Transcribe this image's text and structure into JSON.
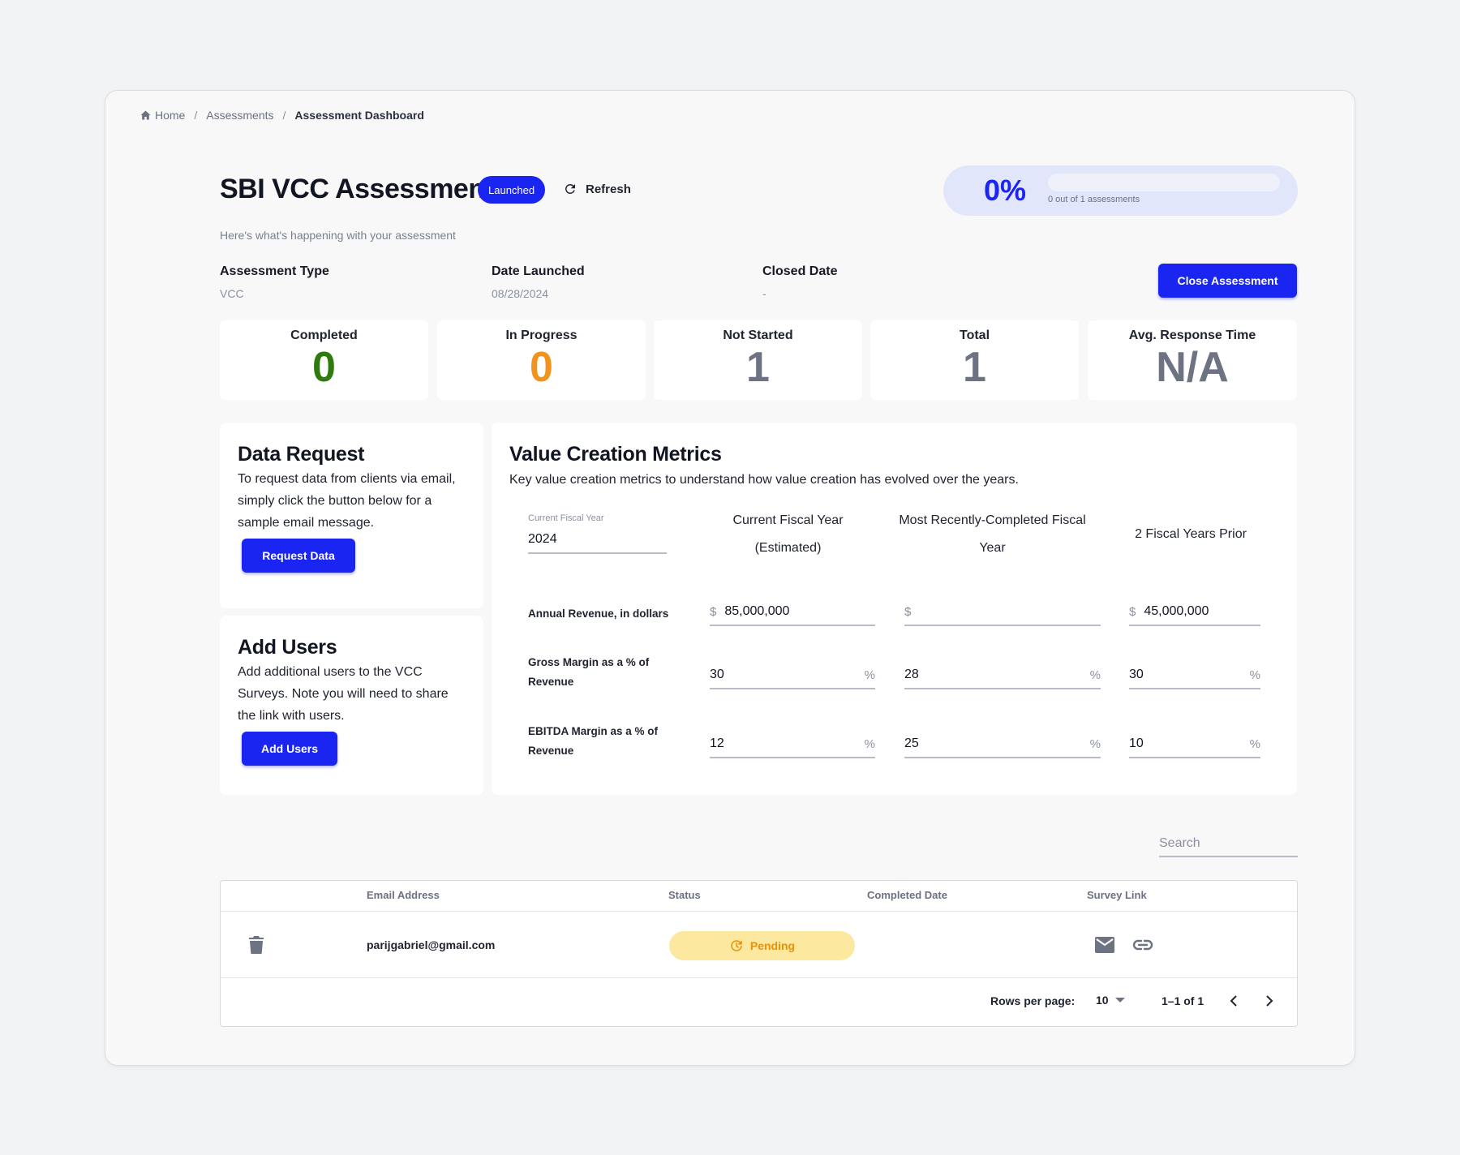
{
  "breadcrumb": {
    "home": "Home",
    "assessments": "Assessments",
    "current": "Assessment Dashboard"
  },
  "header": {
    "title": "SBI VCC Assessment",
    "status_badge": "Launched",
    "refresh_label": "Refresh",
    "subtitle": "Here's what's happening with your assessment"
  },
  "progress": {
    "percent_text": "0%",
    "fraction": 0,
    "caption": "0 out of 1 assessments"
  },
  "info": {
    "type_label": "Assessment Type",
    "type_value": "VCC",
    "launched_label": "Date Launched",
    "launched_value": "08/28/2024",
    "closed_label": "Closed Date",
    "closed_value": "-",
    "close_button": "Close Assessment"
  },
  "stats": [
    {
      "label": "Completed",
      "value": "0",
      "color": "#2f7a0f"
    },
    {
      "label": "In Progress",
      "value": "0",
      "color": "#f0941f"
    },
    {
      "label": "Not Started",
      "value": "1",
      "color": "#6d7382"
    },
    {
      "label": "Total",
      "value": "1",
      "color": "#6d7382"
    },
    {
      "label": "Avg. Response Time",
      "value": "N/A",
      "color": "#6d7382"
    }
  ],
  "data_request": {
    "title": "Data Request",
    "text": "To request data from clients via email, simply click the button below for a sample email message.",
    "button": "Request Data"
  },
  "add_users": {
    "title": "Add Users",
    "text": "Add additional users to the VCC Surveys. Note you will need to share the link with users.",
    "button": "Add Users"
  },
  "metrics": {
    "title": "Value Creation Metrics",
    "subtitle": "Key value creation metrics to understand how value creation has evolved over the years.",
    "fiscal_year_label": "Current Fiscal Year",
    "fiscal_year_value": "2024",
    "columns": [
      "Current Fiscal Year (Estimated)",
      "Most Recently-Completed Fiscal Year",
      "2 Fiscal Years Prior"
    ],
    "rows": [
      {
        "label": "Annual Revenue, in dollars",
        "prefix": "$",
        "suffix": "",
        "values": [
          "85,000,000",
          "",
          "45,000,000"
        ]
      },
      {
        "label": "Gross Margin as a % of Revenue",
        "prefix": "",
        "suffix": "%",
        "values": [
          "30",
          "28",
          "30"
        ]
      },
      {
        "label": "EBITDA Margin as a % of Revenue",
        "prefix": "",
        "suffix": "%",
        "values": [
          "12",
          "25",
          "10"
        ]
      }
    ]
  },
  "search": {
    "placeholder": "Search"
  },
  "table": {
    "headers": {
      "email": "Email Address",
      "status": "Status",
      "completed": "Completed Date",
      "survey": "Survey Link"
    },
    "rows": [
      {
        "email": "parijgabriel@gmail.com",
        "status": "Pending",
        "completed": ""
      }
    ],
    "rows_per_page_label": "Rows per page:",
    "rows_per_page": "10",
    "range": "1–1 of 1"
  },
  "colors": {
    "accent": "#1b25f2",
    "pending_bg": "#fde89f",
    "pending_text": "#e6920e"
  }
}
